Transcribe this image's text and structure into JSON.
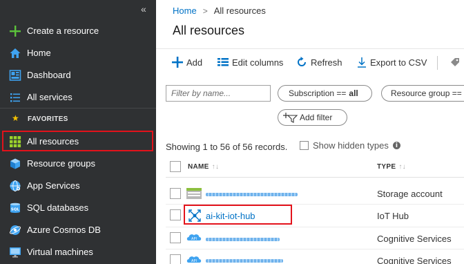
{
  "sidebar": {
    "collapse_label": "«",
    "create": {
      "label": "Create a resource",
      "icon": "plus-icon"
    },
    "items": [
      {
        "label": "Home",
        "icon": "home-icon"
      },
      {
        "label": "Dashboard",
        "icon": "dashboard-icon"
      },
      {
        "label": "All services",
        "icon": "list-icon"
      }
    ],
    "favorites_label": "FAVORITES",
    "favorites": [
      {
        "label": "All resources",
        "icon": "grid-icon",
        "selected": true
      },
      {
        "label": "Resource groups",
        "icon": "cube-icon"
      },
      {
        "label": "App Services",
        "icon": "globe-icon"
      },
      {
        "label": "SQL databases",
        "icon": "sql-icon"
      },
      {
        "label": "Azure Cosmos DB",
        "icon": "cosmos-icon"
      },
      {
        "label": "Virtual machines",
        "icon": "monitor-icon"
      }
    ]
  },
  "breadcrumb": {
    "home": "Home",
    "separator": ">",
    "current": "All resources"
  },
  "title": "All resources",
  "toolbar": {
    "add": "Add",
    "edit_columns": "Edit columns",
    "refresh": "Refresh",
    "export": "Export to CSV"
  },
  "filters": {
    "name_placeholder": "Filter by name...",
    "subscription_label": "Subscription ==",
    "subscription_value": "all",
    "resource_group_label": "Resource group ==",
    "add_filter": "Add filter"
  },
  "records_text": "Showing 1 to 56 of 56 records.",
  "show_hidden_types": "Show hidden types",
  "table": {
    "headers": {
      "name": "NAME",
      "type": "TYPE"
    },
    "rows": [
      {
        "name": "",
        "redacted": true,
        "type": "Storage account",
        "icon": "storage-icon"
      },
      {
        "name": "ai-kit-iot-hub",
        "redacted": false,
        "type": "IoT Hub",
        "icon": "iot-hub-icon"
      },
      {
        "name": "",
        "redacted": true,
        "type": "Cognitive Services",
        "icon": "cognitive-icon"
      },
      {
        "name": "",
        "redacted": true,
        "type": "Cognitive Services",
        "icon": "cognitive-icon"
      }
    ]
  },
  "colors": {
    "sidebar_bg": "#2f3133",
    "link": "#0072c6",
    "highlight": "#e3121b",
    "favorite_star": "#f8c400"
  }
}
